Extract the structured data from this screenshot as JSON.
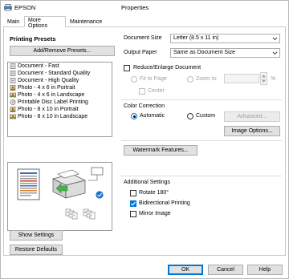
{
  "window": {
    "app_name": "EPSON",
    "title": "Properties"
  },
  "tabs": [
    {
      "label": "Main"
    },
    {
      "label": "More Options"
    },
    {
      "label": "Maintenance"
    }
  ],
  "presets": {
    "title": "Printing Presets",
    "add_remove_label": "Add/Remove Presets...",
    "items": [
      {
        "label": "Document - Fast"
      },
      {
        "label": "Document - Standard Quality"
      },
      {
        "label": "Document - High Quality"
      },
      {
        "label": "Photo - 4 x 6 in Portrait"
      },
      {
        "label": "Photo - 4 x 6 in Landscape"
      },
      {
        "label": "Printable Disc Label Printing"
      },
      {
        "label": "Photo - 8 x 10 in Portrait"
      },
      {
        "label": "Photo - 8 x 10 in Landscape"
      }
    ]
  },
  "left_buttons": {
    "show_settings": "Show Settings",
    "restore_defaults": "Restore Defaults"
  },
  "document_size": {
    "label": "Document Size",
    "value": "Letter (8.5 x 11 in)"
  },
  "output_paper": {
    "label": "Output Paper",
    "value": "Same as Document Size"
  },
  "reduce_enlarge": {
    "label": "Reduce/Enlarge Document",
    "checked": false,
    "fit_to_page": "Fit to Page",
    "zoom_to": "Zoom to",
    "percent": "%",
    "center": "Center"
  },
  "color_correction": {
    "title": "Color Correction",
    "automatic": "Automatic",
    "custom": "Custom",
    "advanced": "Advanced...",
    "image_options": "Image Options..."
  },
  "watermark": {
    "label": "Watermark Features..."
  },
  "additional": {
    "title": "Additional Settings",
    "rotate": "Rotate 180°",
    "rotate_checked": false,
    "bidirectional": "Bidirectional Printing",
    "bidirectional_checked": true,
    "mirror": "Mirror Image",
    "mirror_checked": false
  },
  "footer": {
    "ok": "OK",
    "cancel": "Cancel",
    "help": "Help"
  },
  "colors": {
    "accent": "#0078d7",
    "border": "#adadad",
    "button_bg": "#e1e1e1"
  }
}
